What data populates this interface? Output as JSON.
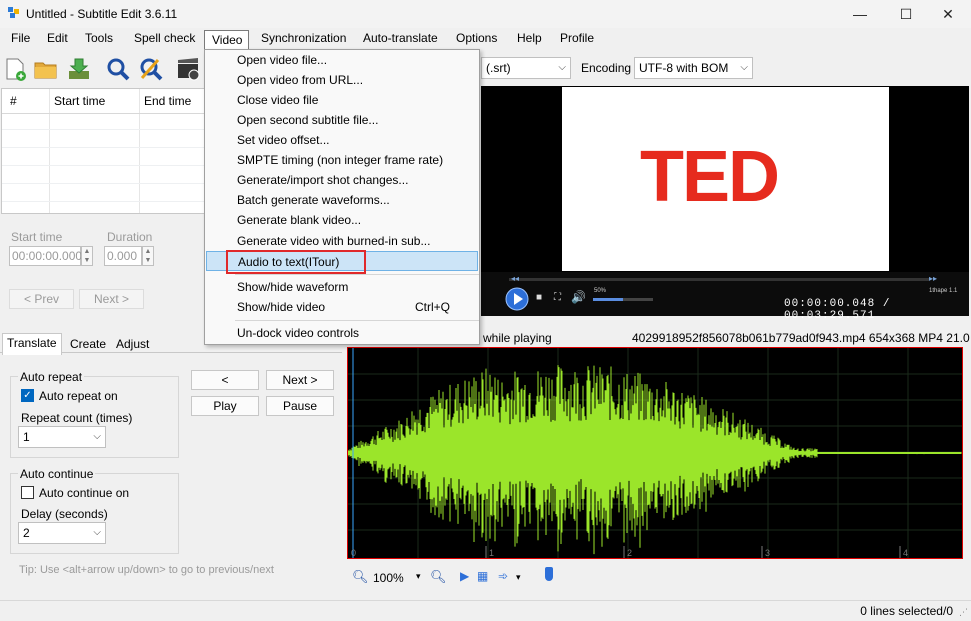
{
  "window": {
    "title": "Untitled - Subtitle Edit 3.6.11",
    "minimize_glyph": "—",
    "maximize_glyph": "☐",
    "close_glyph": "✕"
  },
  "menu": {
    "items": [
      "File",
      "Edit",
      "Tools",
      "Spell check",
      "Video",
      "Synchronization",
      "Auto-translate",
      "Options",
      "Help",
      "Profile"
    ]
  },
  "toolbar": {
    "format_value": "(.srt)",
    "encoding_label": "Encoding",
    "encoding_value": "UTF-8 with BOM"
  },
  "grid": {
    "col_number": "#",
    "col_start": "Start time",
    "col_end": "End time"
  },
  "editor": {
    "start_time_label": "Start time",
    "start_time_value": "00:00:00.000",
    "duration_label": "Duration",
    "duration_value": "0.000",
    "prev_label": "< Prev",
    "next_label": "Next >"
  },
  "tabs": [
    "Translate",
    "Create",
    "Adjust"
  ],
  "translate": {
    "auto_repeat_title": "Auto repeat",
    "auto_repeat_on_label": "Auto repeat on",
    "auto_repeat_on_checked": true,
    "repeat_count_label": "Repeat count (times)",
    "repeat_count_value": "1",
    "auto_continue_title": "Auto continue",
    "auto_continue_on_label": "Auto continue on",
    "auto_continue_on_checked": false,
    "delay_label": "Delay (seconds)",
    "delay_value": "2",
    "prev_btn": "<",
    "next_btn": "Next >",
    "play_btn": "Play",
    "pause_btn": "Pause",
    "tip": "Tip: Use <alt+arrow up/down> to go to previous/next"
  },
  "video": {
    "logo_text": "TED",
    "volume_percent": "50%",
    "time_readout": "00:00:00.048 / 00:03:29.571",
    "corner_label": "1thape 1.1",
    "info_left": "while playing",
    "info_right": "4029918952f856078b061b779ad0f943.mp4 654x368 MP4 21.0"
  },
  "waveform": {
    "ruler_marks": [
      "0",
      "1",
      "2",
      "3",
      "4"
    ],
    "zoom_value": "100%",
    "waveform_color": "#9be52a",
    "border_color": "#dd0000"
  },
  "video_menu": {
    "items": [
      {
        "label": "Open video file...",
        "shortcut": ""
      },
      {
        "label": "Open video from URL...",
        "shortcut": ""
      },
      {
        "label": "Close video file",
        "shortcut": ""
      },
      {
        "label": "Open second subtitle file...",
        "shortcut": ""
      },
      {
        "label": "Set video offset...",
        "shortcut": ""
      },
      {
        "label": "SMPTE timing (non integer frame rate)",
        "shortcut": ""
      },
      {
        "label": "Generate/import shot changes...",
        "shortcut": ""
      },
      {
        "label": "Batch generate waveforms...",
        "shortcut": ""
      },
      {
        "label": "Generate blank video...",
        "shortcut": ""
      },
      {
        "label": "Generate video with burned-in sub...",
        "shortcut": ""
      },
      {
        "label": "Audio to text(ITour)",
        "shortcut": ""
      },
      {
        "label": "Show/hide waveform",
        "shortcut": ""
      },
      {
        "label": "Show/hide video",
        "shortcut": "Ctrl+Q"
      },
      {
        "label": "Un-dock video controls",
        "shortcut": ""
      }
    ]
  },
  "status": {
    "lines_selected": "0 lines selected/0"
  }
}
